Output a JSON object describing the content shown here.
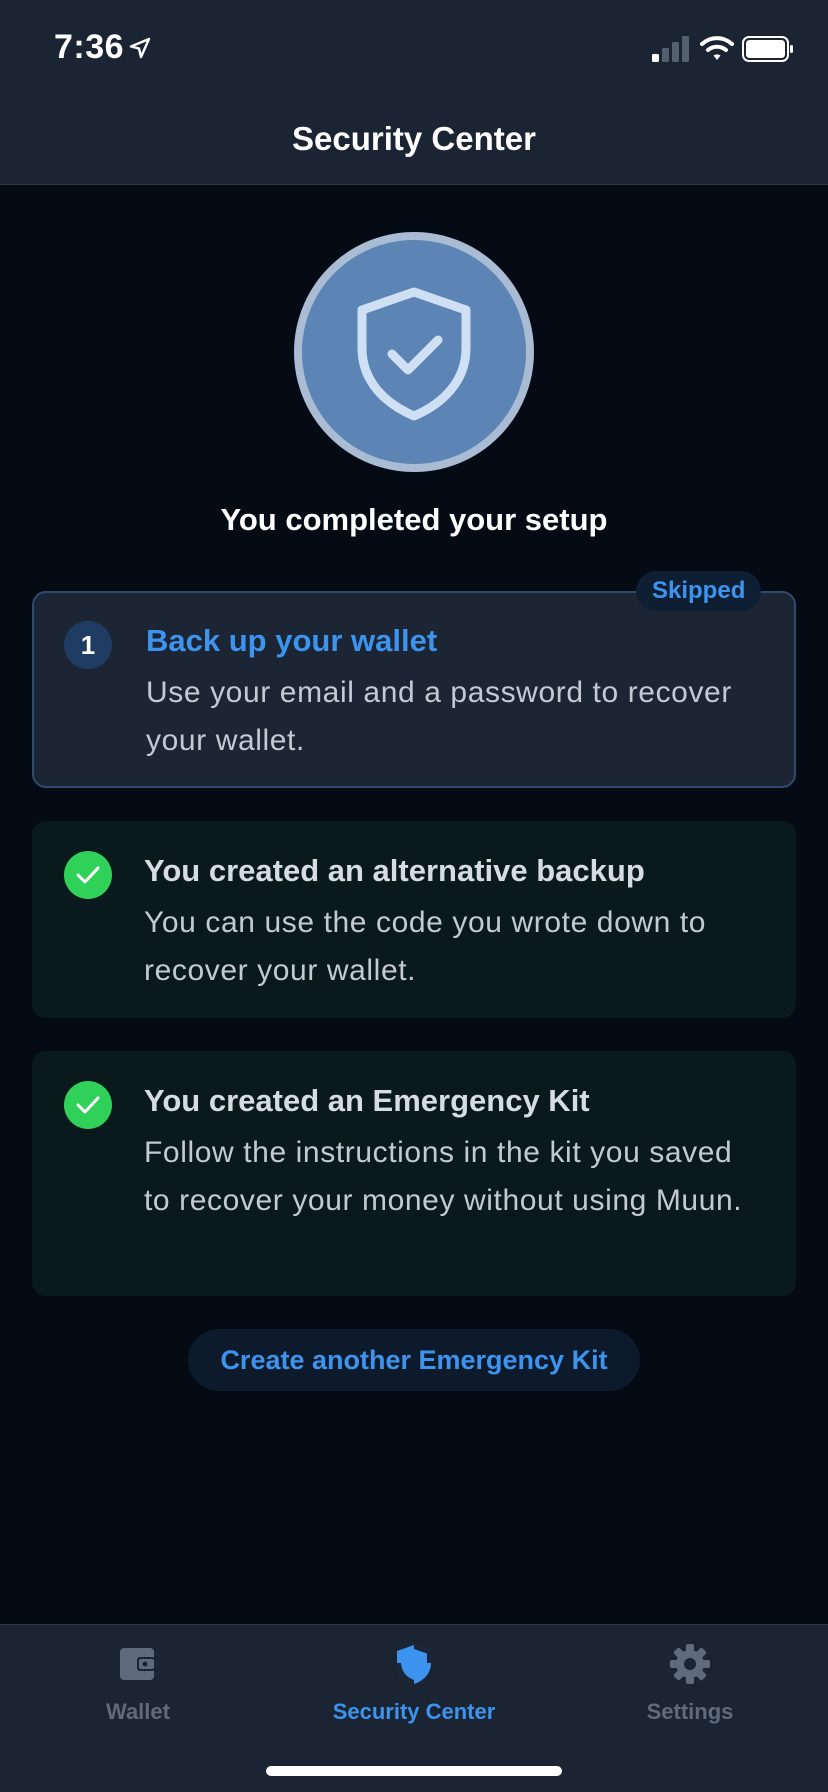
{
  "status_bar": {
    "time": "7:36"
  },
  "header": {
    "title": "Security Center"
  },
  "hero": {
    "status_text": "You completed your setup"
  },
  "steps": [
    {
      "number": "1",
      "badge": "Skipped",
      "title": "Back up your wallet",
      "description": "Use your email and a password to recover your wallet."
    },
    {
      "title": "You created an alternative backup",
      "description": "You can use the code you wrote down to recover your wallet."
    },
    {
      "title": "You created an Emergency Kit",
      "description": "Follow the instructions in the kit you saved to recover your money without using Muun."
    }
  ],
  "actions": {
    "create_kit_label": "Create another Emergency Kit"
  },
  "tab_bar": {
    "items": [
      {
        "label": "Wallet",
        "icon": "wallet-icon"
      },
      {
        "label": "Security Center",
        "icon": "shield-icon",
        "selected": true
      },
      {
        "label": "Settings",
        "icon": "gear-icon"
      }
    ]
  },
  "colors": {
    "accent": "#3d94ee",
    "success": "#2fd158",
    "background": "#040b14",
    "surface": "#1a2433"
  }
}
